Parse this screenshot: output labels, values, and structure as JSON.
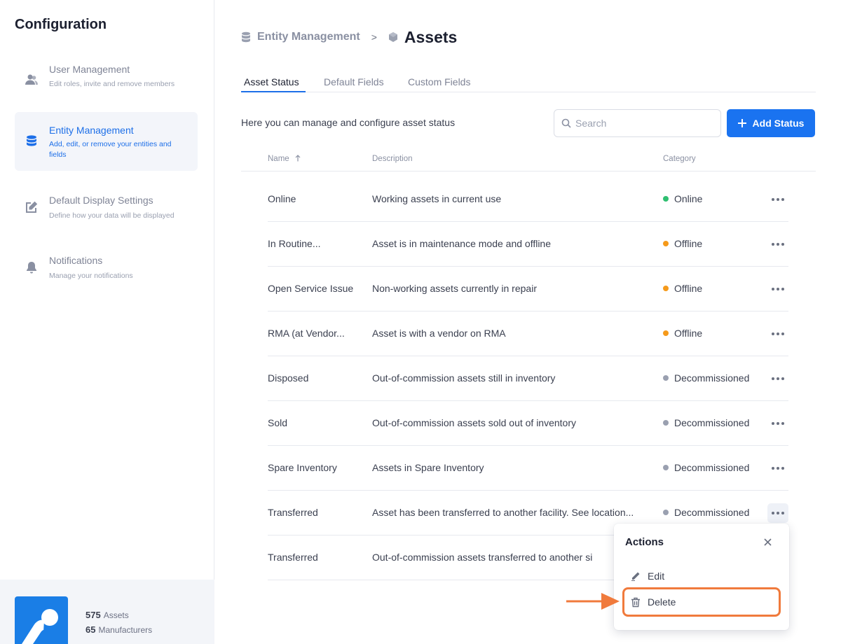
{
  "sidebar": {
    "title": "Configuration",
    "items": [
      {
        "label": "User Management",
        "desc": "Edit roles, invite and remove members",
        "icon": "users-icon"
      },
      {
        "label": "Entity Management",
        "desc": "Add, edit, or remove your entities and fields",
        "icon": "database-icon"
      },
      {
        "label": "Default Display Settings",
        "desc": "Define how your data will be displayed",
        "icon": "edit-square-icon"
      },
      {
        "label": "Notifications",
        "desc": "Manage your notifications",
        "icon": "bell-icon"
      }
    ],
    "footer": {
      "assets_count": "575",
      "assets_label": "Assets",
      "manufacturers_count": "65",
      "manufacturers_label": "Manufacturers"
    }
  },
  "breadcrumb": {
    "parent": "Entity Management",
    "separator": ">",
    "current": "Assets"
  },
  "tabs": [
    {
      "label": "Asset Status"
    },
    {
      "label": "Default Fields"
    },
    {
      "label": "Custom Fields"
    }
  ],
  "intro": "Here you can manage and configure asset status",
  "search": {
    "placeholder": "Search",
    "value": ""
  },
  "add_button": {
    "label": "Add Status"
  },
  "table": {
    "headers": {
      "name": "Name",
      "description": "Description",
      "category": "Category"
    },
    "rows": [
      {
        "name": "Online",
        "description": "Working assets in current use",
        "category": "Online",
        "color": "#2fbf71"
      },
      {
        "name": "In Routine...",
        "description": "Asset is in maintenance mode and offline",
        "category": "Offline",
        "color": "#f59a1b"
      },
      {
        "name": "Open Service Issue",
        "description": "Non-working assets currently in repair",
        "category": "Offline",
        "color": "#f59a1b"
      },
      {
        "name": "RMA (at Vendor...",
        "description": "Asset is with a vendor on RMA",
        "category": "Offline",
        "color": "#f59a1b"
      },
      {
        "name": "Disposed",
        "description": "Out-of-commission assets still in inventory",
        "category": "Decommissioned",
        "color": "#9aa0b0"
      },
      {
        "name": "Sold",
        "description": "Out-of-commission assets sold out of inventory",
        "category": "Decommissioned",
        "color": "#9aa0b0"
      },
      {
        "name": "Spare Inventory",
        "description": "Assets in Spare Inventory",
        "category": "Decommissioned",
        "color": "#9aa0b0"
      },
      {
        "name": "Transferred",
        "description": "Asset has been transferred to another facility. See location...",
        "category": "Decommissioned",
        "color": "#9aa0b0"
      },
      {
        "name": "Transferred",
        "description": "Out-of-commission assets transferred to another si",
        "category": "",
        "color": ""
      }
    ]
  },
  "popover": {
    "title": "Actions",
    "items": [
      {
        "label": "Edit",
        "icon": "pencil-icon"
      },
      {
        "label": "Delete",
        "icon": "trash-icon"
      }
    ]
  },
  "colors": {
    "accent": "#1d6fe8",
    "button": "#1a73f0",
    "highlight": "#f07a3c",
    "online": "#2fbf71",
    "offline": "#f59a1b",
    "decommissioned": "#9aa0b0"
  }
}
